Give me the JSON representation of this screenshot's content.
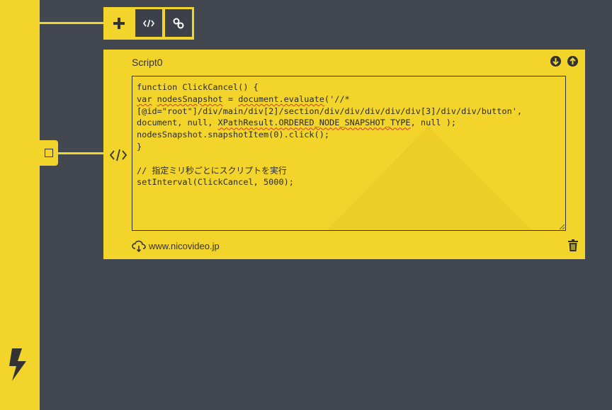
{
  "colors": {
    "accent": "#f3d42b",
    "background": "#43474f",
    "dark": "#333333"
  },
  "sidebar": {
    "logo_icon": "lightning-bolt-icon"
  },
  "toolbar": {
    "add_icon": "plus-icon",
    "code_icon": "code-icon",
    "link_icon": "link-icon"
  },
  "script_panel": {
    "title": "Script0",
    "move_down_icon": "arrow-down-circle-icon",
    "move_up_icon": "arrow-up-circle-icon",
    "code": {
      "line1": "function ClickCancel() {",
      "line2_a": "var",
      "line2_b": " ",
      "line2_c": "nodesSnapshot",
      "line2_d": " = ",
      "line2_e": "document.evaluate",
      "line2_f": "('//*",
      "line3": "[@id=\"root\"]/div/main/div[2]/section/div/div/div/div/div[3]/div/div/button',",
      "line4_a": "document, null, ",
      "line4_b": "XPathResult.ORDERED_NODE_SNAPSHOT_TYPE",
      "line4_c": ", null );",
      "line5": "nodesSnapshot.snapshotItem(0).click();",
      "line6": "}",
      "line7": "",
      "line8": "// 指定ミリ秒ごとにスクリプトを実行",
      "line9": "setInterval(ClickCancel, 5000);"
    },
    "site": "www.nicovideo.jp",
    "cloud_icon": "cloud-icon",
    "delete_icon": "trash-icon"
  }
}
